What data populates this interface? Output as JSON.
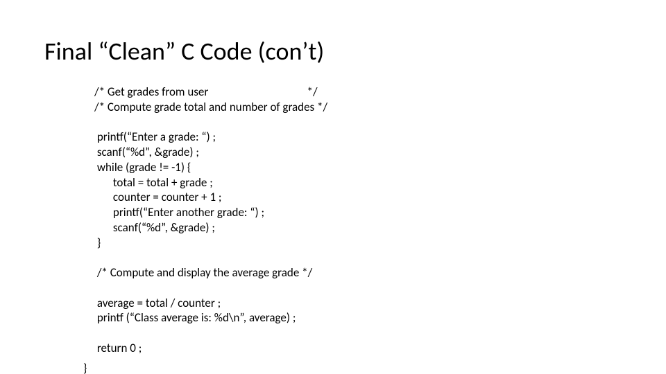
{
  "slide": {
    "title": "Final “Clean” C Code (con’t)",
    "code_lines": [
      "/* Get grades from user                                     */",
      "/* Compute grade total and number of grades */",
      "",
      " printf(“Enter a grade: “) ;",
      " scanf(“%d”, &grade) ;",
      " while (grade != -1) {",
      "       total = total + grade ;",
      "       counter = counter + 1 ;",
      "       printf(“Enter another grade: “) ;",
      "       scanf(“%d”, &grade) ;",
      " }",
      "",
      " /* Compute and display the average grade */",
      "",
      " average = total / counter ;",
      " printf (“Class average is: %d\\n”, average) ;",
      "",
      " return 0 ;"
    ],
    "closing_brace": "}"
  }
}
